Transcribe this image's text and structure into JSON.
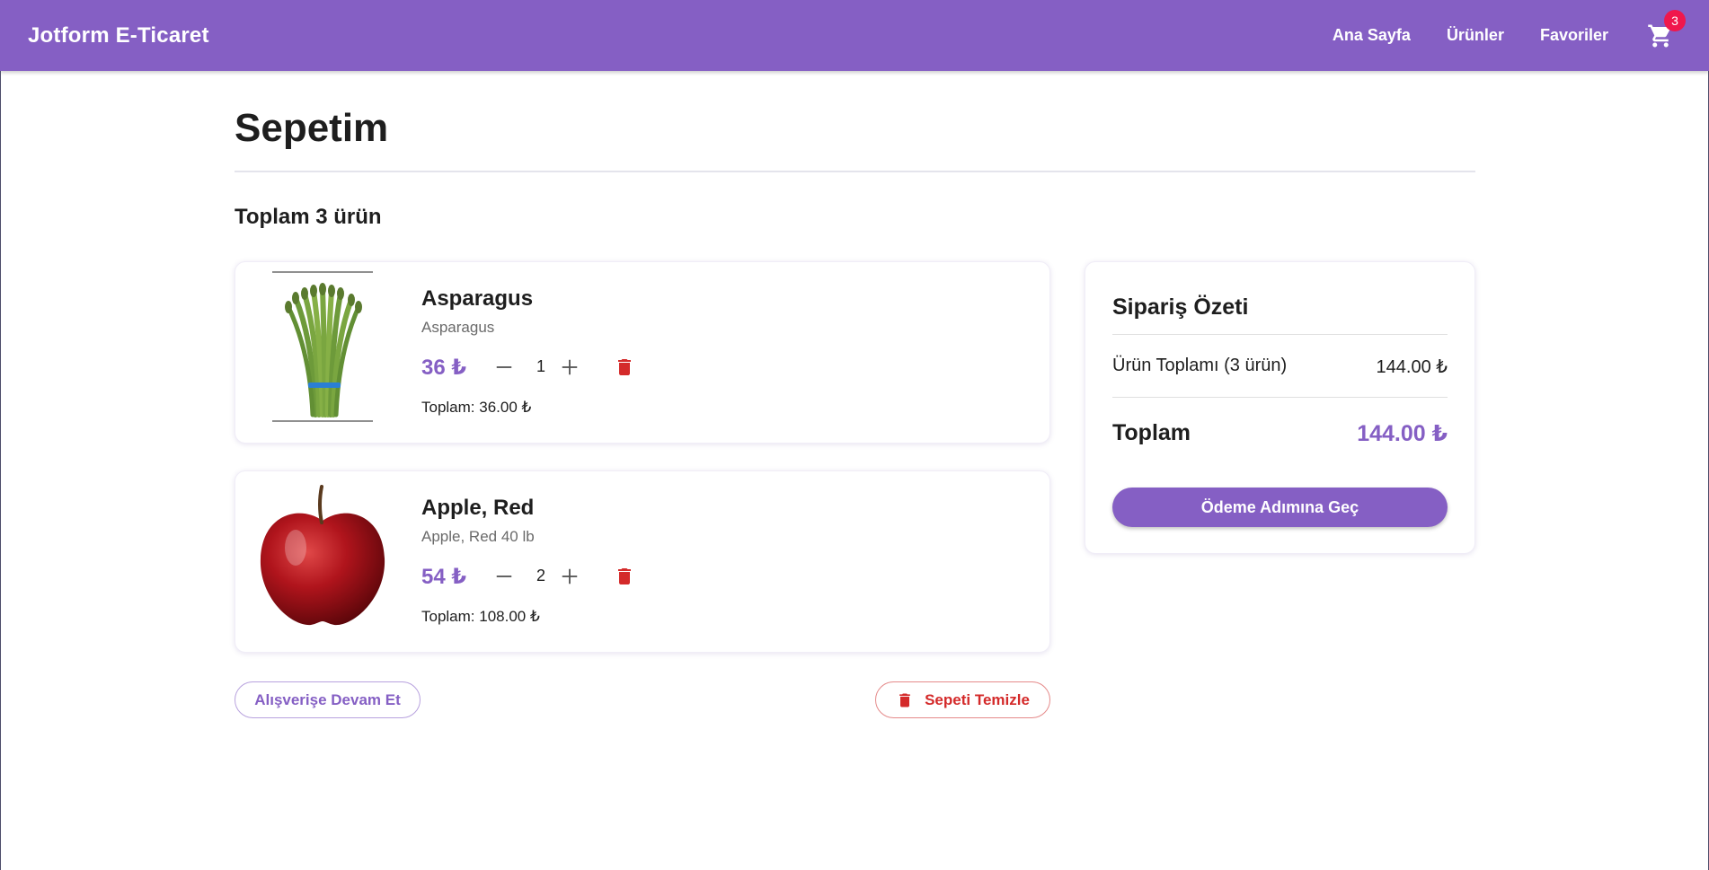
{
  "header": {
    "brand": "Jotform E-Ticaret",
    "nav": [
      "Ana Sayfa",
      "Ürünler",
      "Favoriler"
    ],
    "cart_count": "3",
    "cart_icon": "shopping-cart-icon"
  },
  "page": {
    "title": "Sepetim",
    "count_text": "Toplam 3 ürün"
  },
  "items": [
    {
      "name": "Asparagus",
      "description": "Asparagus",
      "price": "36 ₺",
      "quantity": "1",
      "total": "Toplam: 36.00 ₺",
      "image": "asparagus-image"
    },
    {
      "name": "Apple, Red",
      "description": "Apple, Red 40 lb",
      "price": "54 ₺",
      "quantity": "2",
      "total": "Toplam: 108.00 ₺",
      "image": "red-apple-image"
    }
  ],
  "summary": {
    "title": "Sipariş Özeti",
    "subtotal_label": "Ürün Toplamı (3 ürün)",
    "subtotal_value": "144.00 ₺",
    "total_label": "Toplam",
    "total_value": "144.00 ₺",
    "checkout_label": "Ödeme Adımına Geç"
  },
  "actions": {
    "continue_label": "Alışverişe Devam Et",
    "clear_label": "Sepeti Temizle"
  },
  "colors": {
    "brand": "#855fc4",
    "badge": "#f0174c",
    "danger": "#d42a2a"
  }
}
